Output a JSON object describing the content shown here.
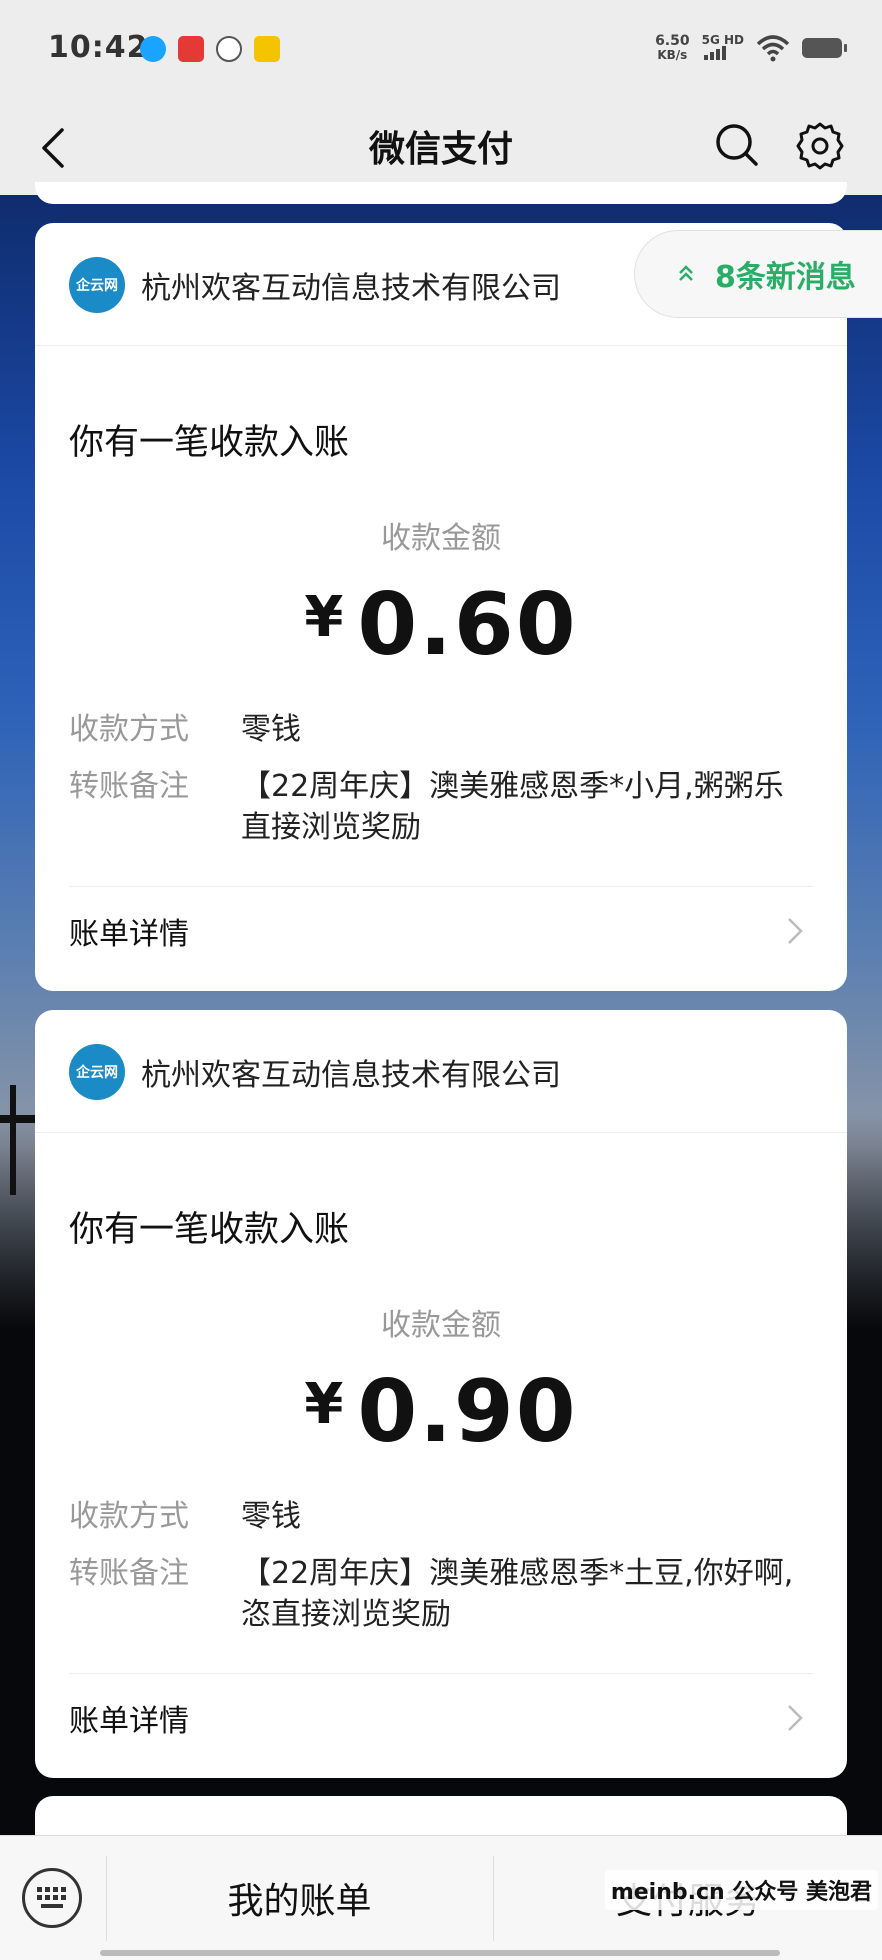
{
  "status_bar": {
    "time": "10:42",
    "net_speed_value": "6.50",
    "net_speed_unit": "KB/s",
    "network": "5G HD"
  },
  "nav": {
    "title": "微信支付"
  },
  "new_messages": {
    "label": "8条新消息"
  },
  "cards": [
    {
      "company": "杭州欢客互动信息技术有限公司",
      "logo_text": "企云网",
      "notice": "你有一笔收款入账",
      "amount_label": "收款金额",
      "currency": "¥",
      "amount": "0.60",
      "method_key": "收款方式",
      "method_value": "零钱",
      "remark_key": "转账备注",
      "remark_value": "【22周年庆】澳美雅感恩季*小月,粥粥乐直接浏览奖励",
      "detail_label": "账单详情"
    },
    {
      "company": "杭州欢客互动信息技术有限公司",
      "logo_text": "企云网",
      "notice": "你有一笔收款入账",
      "amount_label": "收款金额",
      "currency": "¥",
      "amount": "0.90",
      "method_key": "收款方式",
      "method_value": "零钱",
      "remark_key": "转账备注",
      "remark_value": "【22周年庆】澳美雅感恩季*土豆,你好啊,恣直接浏览奖励",
      "detail_label": "账单详情"
    }
  ],
  "bottom_bar": {
    "tab1": "我的账单",
    "tab2": "支付服务"
  },
  "watermark": "meinb.cn 公众号 美泡君",
  "colors": {
    "accent_green": "#2aae67",
    "logo_blue": "#1a8bc7"
  }
}
